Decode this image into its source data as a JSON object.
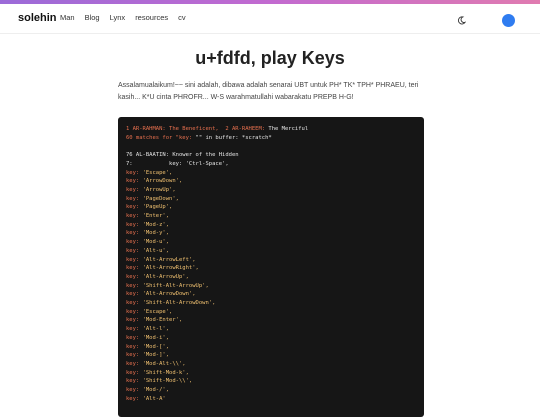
{
  "header": {
    "brand": "solehin",
    "nav": [
      "Man",
      "Blog",
      "Lynx",
      "resources",
      "cv"
    ]
  },
  "page": {
    "title": "u+fdfd, play Keys",
    "intro": "Assalamualaikum!~~ sini adalah, dibawa adalah senarai UBT untuk PH* TK* TPH* PHRAEU, teri kasih... K*U cinta PHROFR... W-S warahmatullahi wabarakatu PREPB H-G!"
  },
  "code": {
    "line1_a": "1 AR-RAHMAN: The Beneficent,",
    "line1_b": "2 AR-RAHEEM:",
    "line1_c": "The Merciful",
    "line2_a": "60 matches for \"key:",
    "line2_b": "\"\" in buffer: *scratch*",
    "line3": "76 AL-BAATIN: Knower of the Hidden",
    "line4": "7:           key: 'Ctrl-Space',",
    "key_prefix": "key:",
    "keys": [
      "'Escape',",
      "'ArrowDown',",
      "'ArrowUp',",
      "'PageDown',",
      "'PageUp',",
      "'Enter',",
      "'Mod-z',",
      "'Mod-y',",
      "'Mod-u',",
      "'Alt-u',",
      "'Alt-ArrowLeft',",
      "'Alt-ArrowRight',",
      "'Alt-ArrowUp',",
      "'Shift-Alt-ArrowUp',",
      "'Alt-ArrowDown',",
      "'Shift-Alt-ArrowDown',",
      "'Escape',",
      "'Mod-Enter',",
      "'Alt-l',",
      "'Mod-i',",
      "'Mod-[',",
      "'Mod-]',",
      "'Mod-Alt-\\\\',",
      "'Shift-Mod-k',",
      "'Shift-Mod-\\\\',",
      "'Mod-/',",
      "'Alt-A'"
    ]
  }
}
